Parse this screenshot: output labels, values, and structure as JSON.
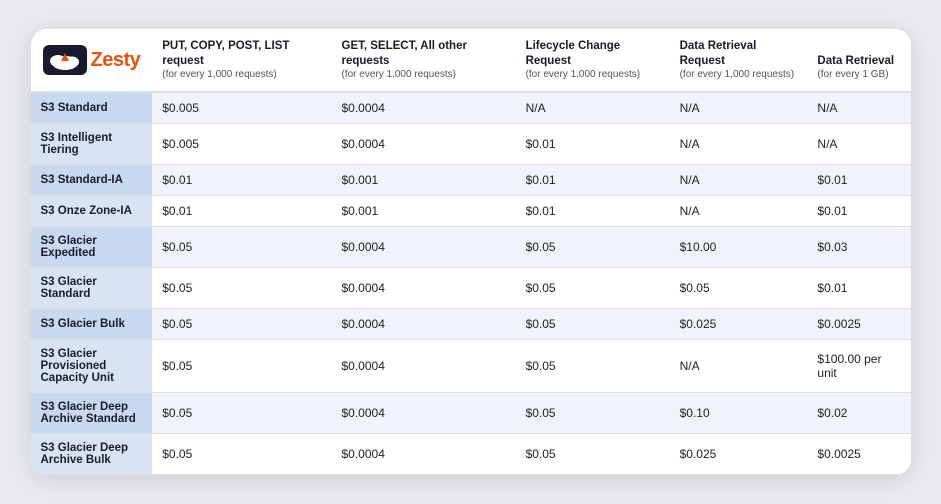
{
  "logo": {
    "brand": "esty",
    "brand_prefix": "Z"
  },
  "columns": [
    {
      "id": "label",
      "main": "",
      "sub": ""
    },
    {
      "id": "put_copy",
      "main": "PUT, COPY, POST, LIST request",
      "sub": "(for every 1,000 requests)"
    },
    {
      "id": "get_select",
      "main": "GET, SELECT, All other requests",
      "sub": "(for every 1,000 requests)"
    },
    {
      "id": "lifecycle",
      "main": "Lifecycle Change Request",
      "sub": "(for every 1,000 requests)"
    },
    {
      "id": "data_retrieval_req",
      "main": "Data Retrieval Request",
      "sub": "(for every 1,000 requests)"
    },
    {
      "id": "data_retrieval",
      "main": "Data Retrieval",
      "sub": "(for every 1 GB)"
    }
  ],
  "rows": [
    {
      "label": "S3 Standard",
      "put_copy": "$0.005",
      "get_select": "$0.0004",
      "lifecycle": "N/A",
      "data_retrieval_req": "N/A",
      "data_retrieval": "N/A"
    },
    {
      "label": "S3 Intelligent Tiering",
      "put_copy": "$0.005",
      "get_select": "$0.0004",
      "lifecycle": "$0.01",
      "data_retrieval_req": "N/A",
      "data_retrieval": "N/A"
    },
    {
      "label": "S3 Standard-IA",
      "put_copy": "$0.01",
      "get_select": "$0.001",
      "lifecycle": "$0.01",
      "data_retrieval_req": "N/A",
      "data_retrieval": "$0.01"
    },
    {
      "label": "S3 Onze Zone-IA",
      "put_copy": "$0.01",
      "get_select": "$0.001",
      "lifecycle": "$0.01",
      "data_retrieval_req": "N/A",
      "data_retrieval": "$0.01"
    },
    {
      "label": "S3 Glacier Expedited",
      "put_copy": "$0.05",
      "get_select": "$0.0004",
      "lifecycle": "$0.05",
      "data_retrieval_req": "$10.00",
      "data_retrieval": "$0.03"
    },
    {
      "label": "S3 Glacier Standard",
      "put_copy": "$0.05",
      "get_select": "$0.0004",
      "lifecycle": "$0.05",
      "data_retrieval_req": "$0.05",
      "data_retrieval": "$0.01"
    },
    {
      "label": "S3 Glacier Bulk",
      "put_copy": "$0.05",
      "get_select": "$0.0004",
      "lifecycle": "$0.05",
      "data_retrieval_req": "$0.025",
      "data_retrieval": "$0.0025"
    },
    {
      "label": "S3 Glacier Provisioned Capacity Unit",
      "put_copy": "$0.05",
      "get_select": "$0.0004",
      "lifecycle": "$0.05",
      "data_retrieval_req": "N/A",
      "data_retrieval": "$100.00 per unit"
    },
    {
      "label": "S3 Glacier Deep Archive Standard",
      "put_copy": "$0.05",
      "get_select": "$0.0004",
      "lifecycle": "$0.05",
      "data_retrieval_req": "$0.10",
      "data_retrieval": "$0.02"
    },
    {
      "label": "S3 Glacier Deep Archive Bulk",
      "put_copy": "$0.05",
      "get_select": "$0.0004",
      "lifecycle": "$0.05",
      "data_retrieval_req": "$0.025",
      "data_retrieval": "$0.0025"
    }
  ]
}
